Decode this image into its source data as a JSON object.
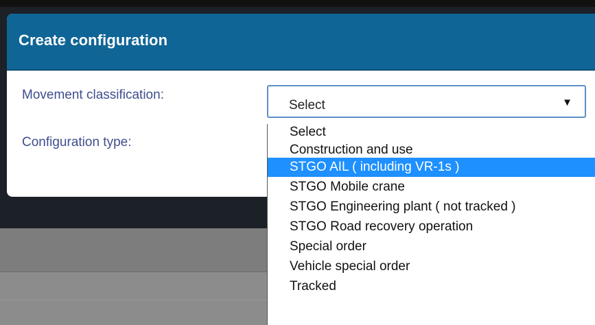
{
  "dialog": {
    "title": "Create configuration"
  },
  "form": {
    "movement_label": "Movement classification:",
    "config_type_label": "Configuration type:"
  },
  "select": {
    "value": "Select",
    "arrow_icon": "dropdown-triangle-icon"
  },
  "dropdown": {
    "options": [
      "Select",
      "Construction and use",
      "STGO AIL ( including VR-1s )",
      "STGO Mobile crane",
      "STGO Engineering plant ( not tracked )",
      "STGO Road recovery operation",
      "Special order",
      "Vehicle special order",
      "Tracked"
    ],
    "highlighted_index": 2
  },
  "colors": {
    "header": "#0f6596",
    "label": "#3f4d8e",
    "highlight": "#1e90ff"
  }
}
